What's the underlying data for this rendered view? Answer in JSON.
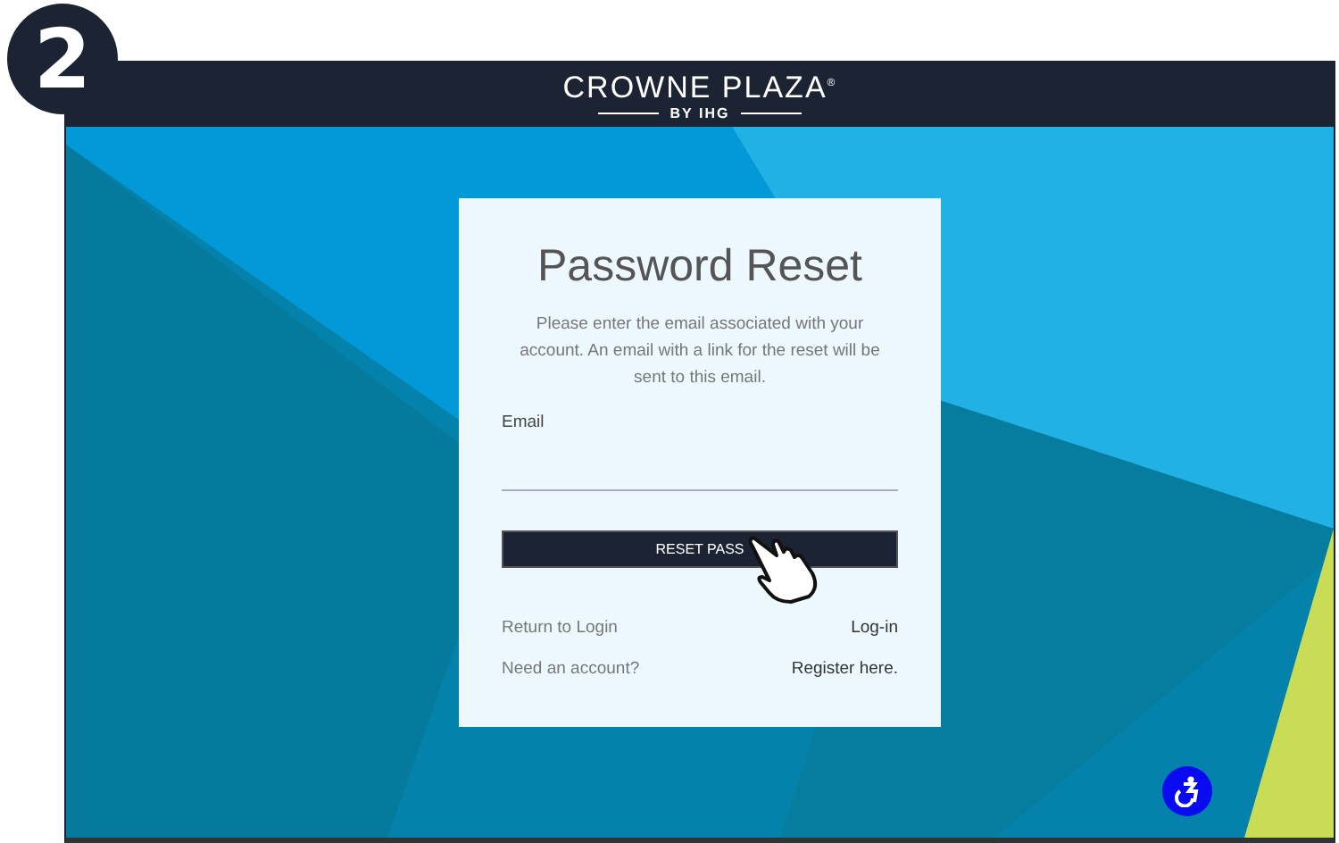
{
  "step": "2",
  "header": {
    "brand": "CROWNE PLAZA$^{®}$",
    "sub_brand": "BY IHG"
  },
  "card": {
    "title": "Password Reset",
    "description": "Please enter the email associated with your account. An email with a link for the reset will be sent to this email.",
    "email_label": "Email",
    "button": "RESET PASS",
    "links": [
      {
        "label": "Return to Login",
        "link": "Log-in"
      },
      {
        "label": "Need an account?",
        "link": "Register here."
      }
    ]
  }
}
